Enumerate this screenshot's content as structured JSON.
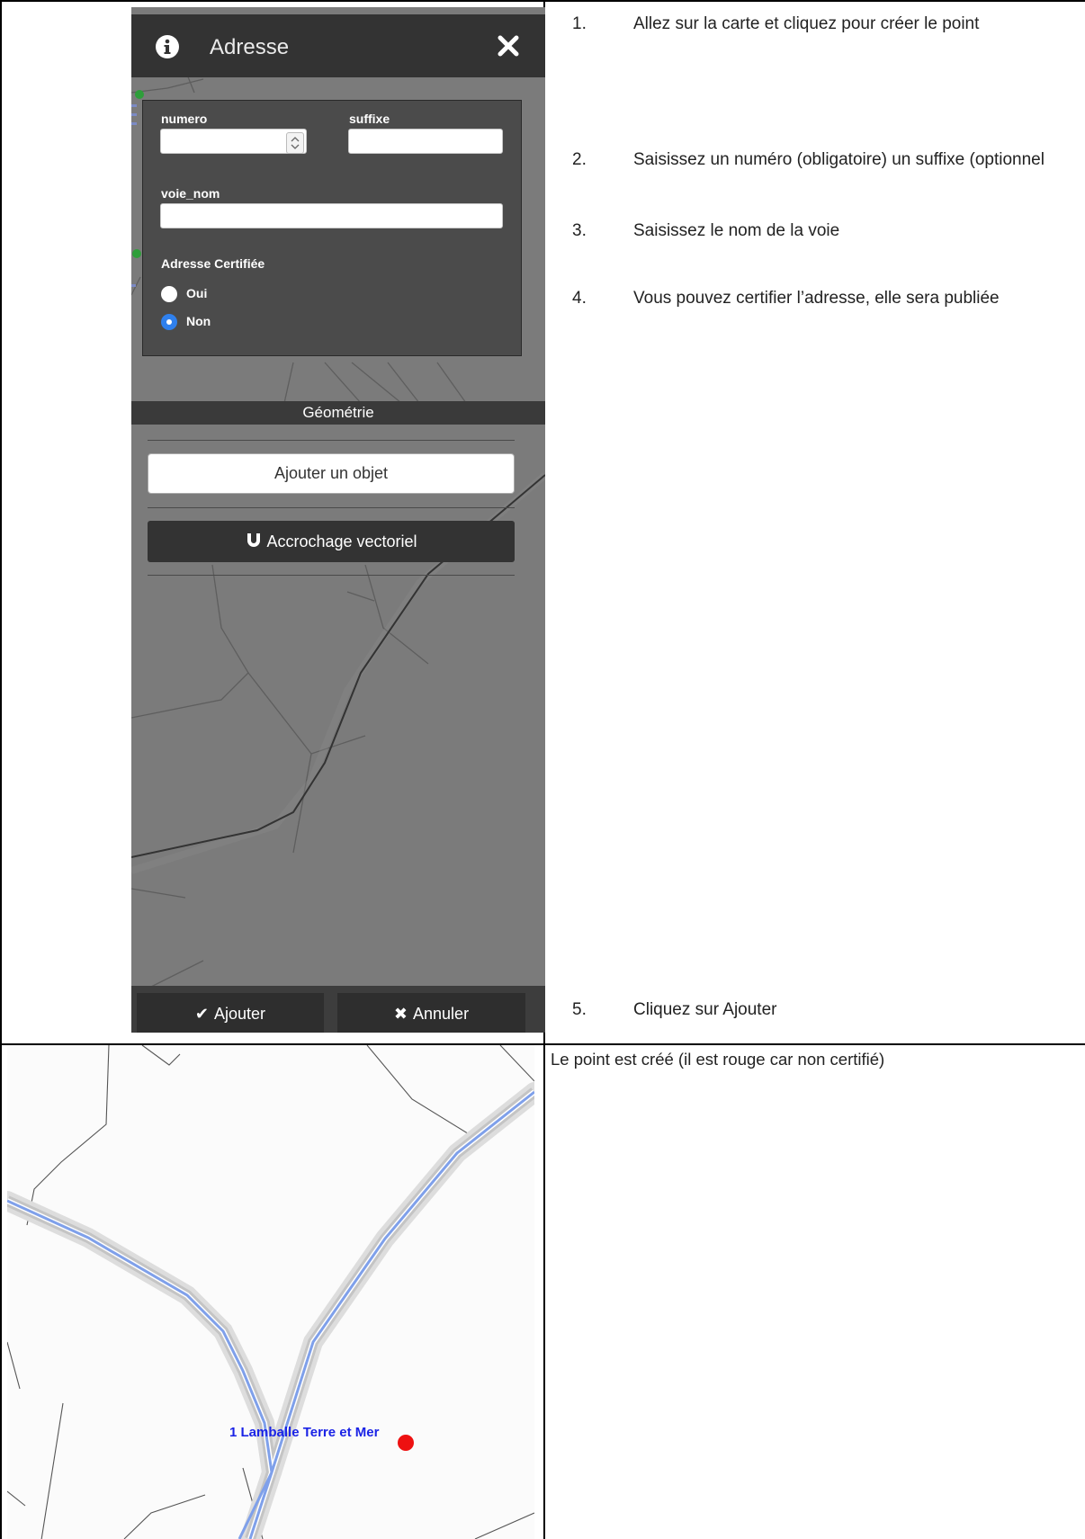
{
  "panel": {
    "title": "Adresse",
    "icons": {
      "info": "info-circle-icon",
      "close": "close-x-icon"
    },
    "fields": {
      "numero": {
        "label": "numero",
        "value": ""
      },
      "suffixe": {
        "label": "suffixe",
        "value": ""
      },
      "voie_nom": {
        "label": "voie_nom",
        "value": ""
      }
    },
    "certified": {
      "label": "Adresse Certifiée",
      "options": [
        "Oui",
        "Non"
      ],
      "selected": "Non"
    },
    "geometry_title": "Géométrie",
    "add_object_label": "Ajouter un objet",
    "snap_label": "Accrochage vectoriel",
    "snap_icon": "magnet-icon",
    "submit_label": "Ajouter",
    "cancel_label": "Annuler",
    "submit_icon": "check-icon",
    "cancel_icon": "x-icon"
  },
  "steps": [
    {
      "num": "1.",
      "text": "Allez sur la carte et cliquez pour créer le point"
    },
    {
      "num": "2.",
      "text": "Saisissez un numéro (obligatoire) un suffixe (optionnel"
    },
    {
      "num": "3.",
      "text": "Saisissez le nom de la voie"
    },
    {
      "num": "4.",
      "text": "Vous pouvez certifier l’adresse, elle sera publiée"
    },
    {
      "num": "5.",
      "text": "Cliquez sur Ajouter"
    }
  ],
  "result": {
    "caption": "Le point est créé (il est rouge car non certifié)",
    "point_label": "1  Lamballe Terre et Mer",
    "point_color": "#ee1111"
  }
}
